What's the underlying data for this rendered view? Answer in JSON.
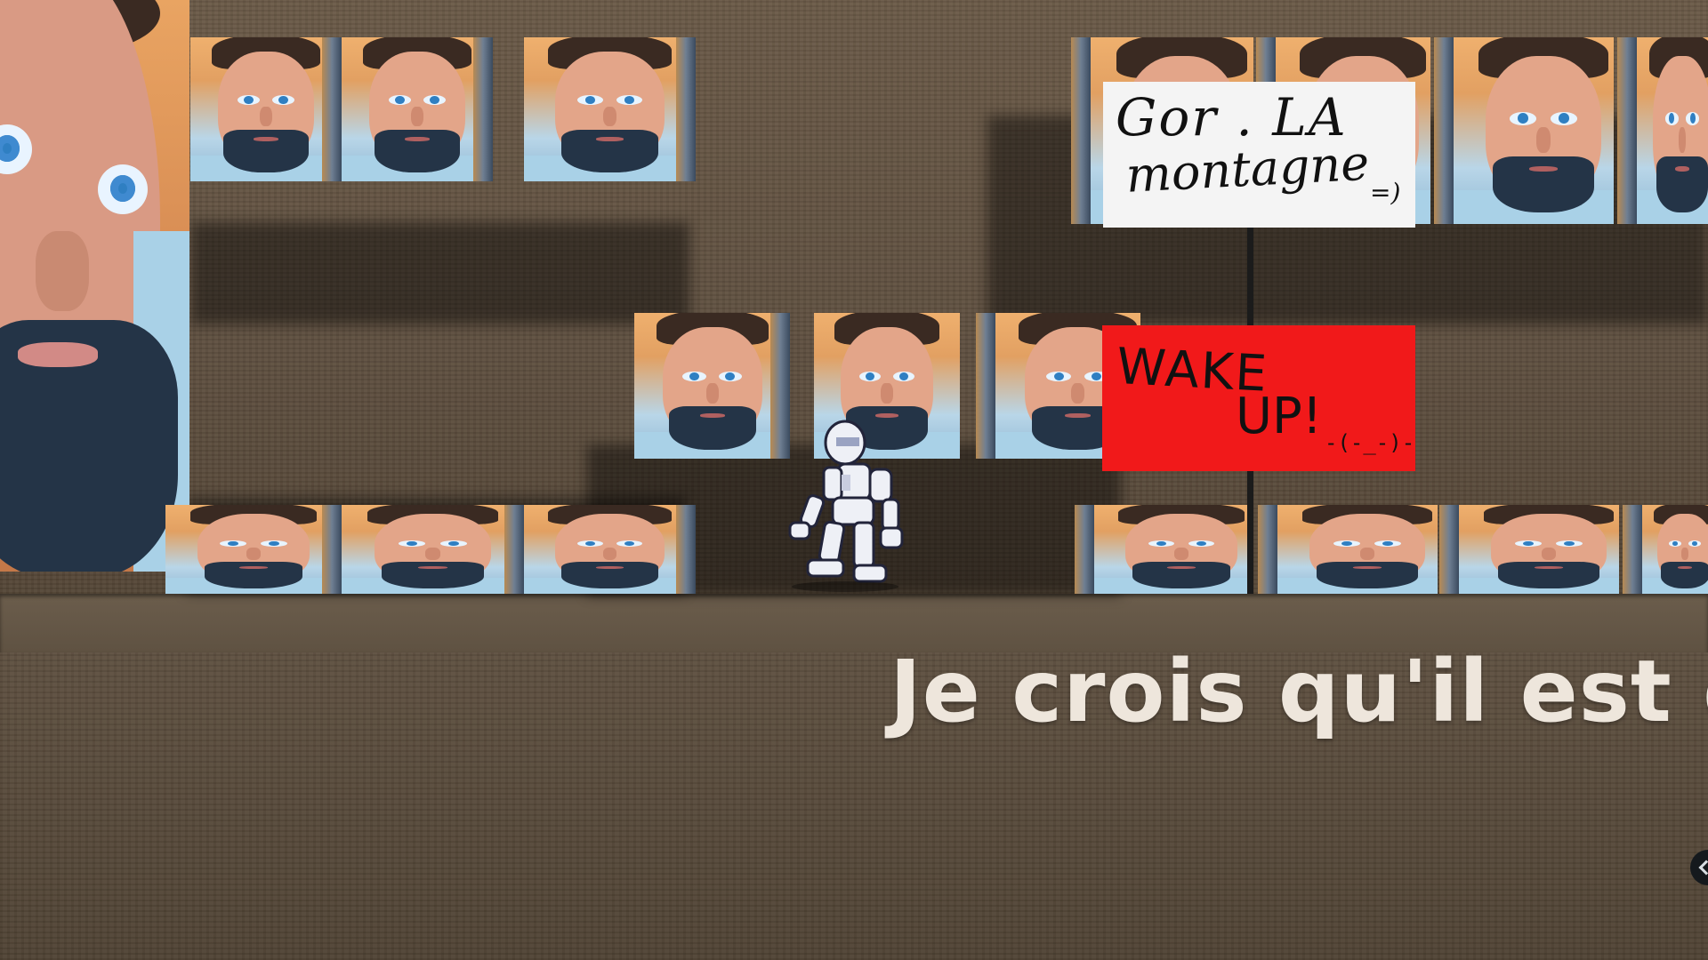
{
  "scene": {
    "subtitle": "Je crois qu'il est de",
    "signs": {
      "white_line1": "Gor . LA",
      "white_line2": "montagne",
      "white_emote": "=)",
      "red_line1": "WAKE",
      "red_line2": "UP!",
      "red_emote": "-(-_-)-"
    }
  },
  "colors": {
    "wall": "#5e4f3f",
    "ground": "#4f4233",
    "sign_red": "#f1191a",
    "sign_white": "#f4f4f4",
    "subtitle": "#eee6dc"
  },
  "icons": {
    "hud": "chevron-left-icon",
    "player": "robot-character-icon"
  }
}
